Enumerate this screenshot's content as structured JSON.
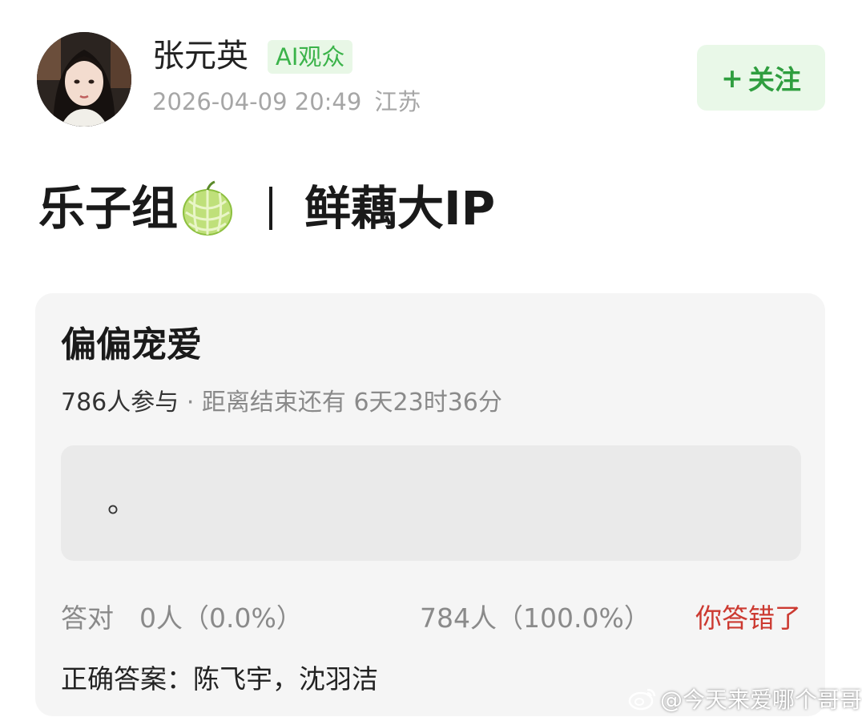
{
  "header": {
    "user_name": "张元英",
    "badge": "AI观众",
    "timestamp": "2026-04-09 20:49",
    "location": "江苏",
    "follow_plus": "+",
    "follow_label": "关注"
  },
  "post": {
    "title_left": "乐子组",
    "title_emoji": "melon",
    "title_right": "鲜藕大IP"
  },
  "quiz": {
    "title": "偏偏宠爱",
    "participants": "786人参与",
    "separator": "·",
    "deadline": "距离结束还有 6天23时36分",
    "answer_text": "。",
    "correct_label": "答对",
    "correct_count": "0人（0.0%）",
    "wrong_count": "784人（100.0%）",
    "wrong_status": "你答错了",
    "correct_answer": "正确答案：陈飞宇，沈羽洁"
  },
  "watermark": {
    "text": "@今天来爱哪个哥哥",
    "icon": "weibo-logo"
  },
  "colors": {
    "badge_green": "#3bb34a",
    "follow_bg": "#e9f8e8",
    "wrong_red": "#cc3a31",
    "card_bg": "#f5f5f5"
  }
}
